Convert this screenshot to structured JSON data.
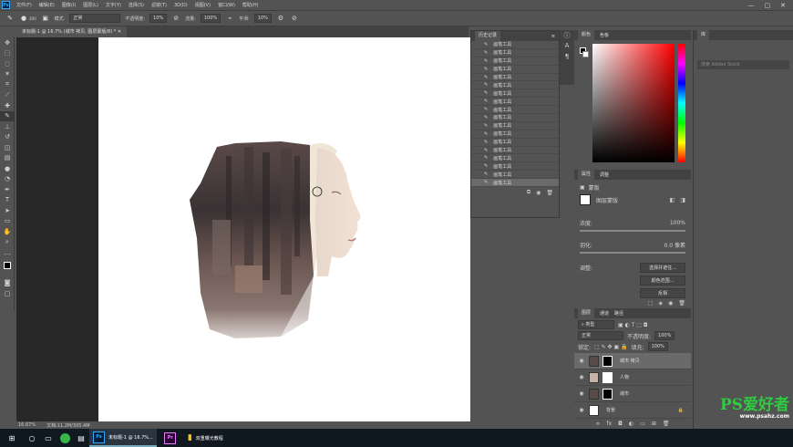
{
  "app": {
    "logo": "Ps",
    "window_controls": [
      "—",
      "▢",
      "✕"
    ]
  },
  "menu": [
    "文件(F)",
    "编辑(E)",
    "图像(I)",
    "图层(L)",
    "文字(Y)",
    "选择(S)",
    "滤镜(T)",
    "3D(D)",
    "视图(V)",
    "窗口(W)",
    "帮助(H)"
  ],
  "options": {
    "mode_label": "模式:",
    "mode_value": "正常",
    "opacity_label": "不透明度:",
    "opacity_value": "10%",
    "flow_label": "流量:",
    "flow_value": "100%",
    "smooth_label": "平滑:",
    "smooth_value": "10%",
    "brush_size": "300"
  },
  "document": {
    "tab_title": "未标题-1 @ 16.7% (城市 拷贝, 图层蒙版/8) *",
    "zoom": "16.67%",
    "doc_info": "文档:11.2M/305.4M"
  },
  "history": {
    "title": "历史记录",
    "items": [
      "画笔工具",
      "画笔工具",
      "画笔工具",
      "画笔工具",
      "画笔工具",
      "画笔工具",
      "画笔工具",
      "画笔工具",
      "画笔工具",
      "画笔工具",
      "画笔工具",
      "画笔工具",
      "画笔工具",
      "画笔工具",
      "画笔工具",
      "画笔工具",
      "画笔工具",
      "画笔工具"
    ]
  },
  "color_panel": {
    "tabs": [
      "颜色",
      "色板"
    ]
  },
  "properties": {
    "tabs": [
      "属性",
      "调整"
    ],
    "subtitle": "蒙版",
    "mask_label": "图层蒙版",
    "density_label": "浓度:",
    "density_value": "100%",
    "feather_label": "羽化:",
    "feather_value": "0.0 像素",
    "adjust_label": "调整:",
    "btn_select_mask": "选择并遮住...",
    "btn_color_range": "颜色范围...",
    "btn_invert": "反相"
  },
  "layers": {
    "tabs": [
      "图层",
      "通道",
      "路径"
    ],
    "filter_label": "类型",
    "blend_mode": "正常",
    "opacity_label": "不透明度:",
    "opacity_value": "100%",
    "lock_label": "锁定:",
    "fill_label": "填充:",
    "fill_value": "100%",
    "items": [
      {
        "name": "城市 拷贝",
        "selected": true
      },
      {
        "name": "人物",
        "selected": false
      },
      {
        "name": "城市",
        "selected": false
      },
      {
        "name": "背景",
        "selected": false
      }
    ]
  },
  "far_panel": {
    "tab": "库",
    "search_placeholder": "搜索 Adobe Stock"
  },
  "taskbar": {
    "app1": "未标题-1 @ 16.7%...",
    "app2": "双重曝光教程"
  },
  "watermark": {
    "text": "PS爱好者",
    "url": "www.psahz.com"
  },
  "colors": {
    "ps_bg": "#535353",
    "canvas": "#ffffff",
    "accent_ps": "#31a8ff"
  }
}
